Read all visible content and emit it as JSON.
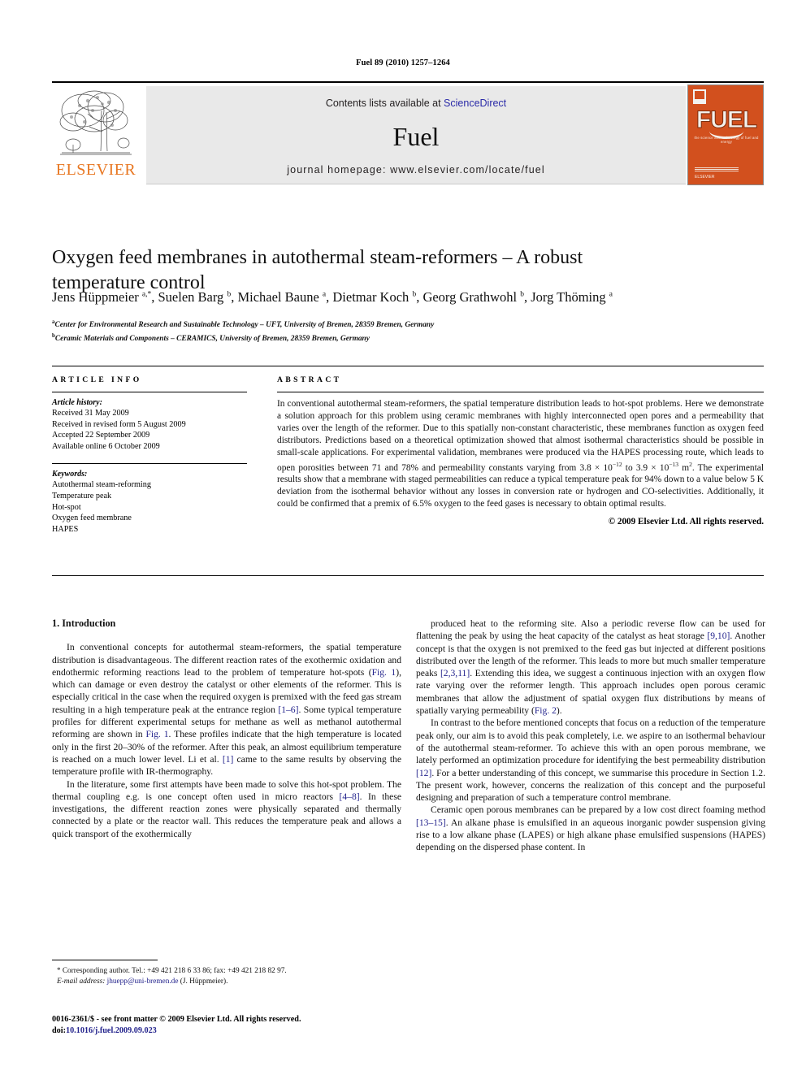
{
  "running_head": "Fuel 89 (2010) 1257–1264",
  "masthead": {
    "publisher_name": "ELSEVIER",
    "contents_prefix": "Contents lists available at ",
    "contents_link": "ScienceDirect",
    "journal_name": "Fuel",
    "homepage": "journal homepage: www.elsevier.com/locate/fuel",
    "cover_title": "FUEL",
    "cover_subtitle": "the science and technology of fuel and energy",
    "cover_brand": "ELSEVIER"
  },
  "article": {
    "title": "Oxygen feed membranes in autothermal steam-reformers – A robust temperature control",
    "authors_html": "Jens Hüppmeier <sup>a,*</sup>, Suelen Barg <sup>b</sup>, Michael Baune <sup>a</sup>, Dietmar Koch <sup>b</sup>, Georg Grathwohl <sup>b</sup>, Jorg Thöming <sup>a</sup>",
    "affiliation_a": "Center for Environmental Research and Sustainable Technology – UFT, University of Bremen, 28359 Bremen, Germany",
    "affiliation_b": "Ceramic Materials and Components – CERAMICS, University of Bremen, 28359 Bremen, Germany"
  },
  "article_info": {
    "heading": "ARTICLE INFO",
    "history_label": "Article history:",
    "history": [
      "Received 31 May 2009",
      "Received in revised form 5 August 2009",
      "Accepted 22 September 2009",
      "Available online 6 October 2009"
    ],
    "keywords_label": "Keywords:",
    "keywords": [
      "Autothermal steam-reforming",
      "Temperature peak",
      "Hot-spot",
      "Oxygen feed membrane",
      "HAPES"
    ]
  },
  "abstract": {
    "heading": "ABSTRACT",
    "body_html": "In conventional autothermal steam-reformers, the spatial temperature distribution leads to hot-spot problems. Here we demonstrate a solution approach for this problem using ceramic membranes with highly interconnected open pores and a permeability that varies over the length of the reformer. Due to this spatially non-constant characteristic, these membranes function as oxygen feed distributors. Predictions based on a theoretical optimization showed that almost isothermal characteristics should be possible in small-scale applications. For experimental validation, membranes were produced via the HAPES processing route, which leads to open porosities between 71 and 78% and permeability constants varying from 3.8 × 10<sup class=\"sm\">−12</sup> to 3.9 × 10<sup class=\"sm\">−13</sup> m<sup class=\"sm\">2</sup>. The experimental results show that a membrane with staged permeabilities can reduce a typical temperature peak for 94% down to a value below 5 K deviation from the isothermal behavior without any losses in conversion rate or hydrogen and CO-selectivities. Additionally, it could be confirmed that a premix of 6.5% oxygen to the feed gases is necessary to obtain optimal results.",
    "copyright": "© 2009 Elsevier Ltd. All rights reserved."
  },
  "body": {
    "section_heading": "1. Introduction",
    "left_p1_html": "In conventional concepts for autothermal steam-reformers, the spatial temperature distribution is disadvantageous. The different reaction rates of the exothermic oxidation and endothermic reforming reactions lead to the problem of temperature hot-spots (<span class=\"ref\">Fig. 1</span>), which can damage or even destroy the catalyst or other elements of the reformer. This is especially critical in the case when the required oxygen is premixed with the feed gas stream resulting in a high temperature peak at the entrance region <span class=\"ref\">[1–6]</span>. Some typical temperature profiles for different experimental setups for methane as well as methanol autothermal reforming are shown in <span class=\"ref\">Fig. 1</span>. These profiles indicate that the high temperature is located only in the first 20–30% of the reformer. After this peak, an almost equilibrium temperature is reached on a much lower level. Li et al. <span class=\"ref\">[1]</span> came to the same results by observing the temperature profile with IR-thermography.",
    "left_p2_html": "In the literature, some first attempts have been made to solve this hot-spot problem. The thermal coupling e.g. is one concept often used in micro reactors <span class=\"ref\">[4–8]</span>. In these investigations, the different reaction zones were physically separated and thermally connected by a plate or the reactor wall. This reduces the temperature peak and allows a quick transport of the exothermically",
    "right_p1_html": "produced heat to the reforming site. Also a periodic reverse flow can be used for flattening the peak by using the heat capacity of the catalyst as heat storage <span class=\"ref\">[9,10]</span>. Another concept is that the oxygen is not premixed to the feed gas but injected at different positions distributed over the length of the reformer. This leads to more but much smaller temperature peaks <span class=\"ref\">[2,3,11]</span>. Extending this idea, we suggest a continuous injection with an oxygen flow rate varying over the reformer length. This approach includes open porous ceramic membranes that allow the adjustment of spatial oxygen flux distributions by means of spatially varying permeability (<span class=\"ref\">Fig. 2</span>).",
    "right_p2_html": "In contrast to the before mentioned concepts that focus on a reduction of the temperature peak only, our aim is to avoid this peak completely, i.e. we aspire to an isothermal behaviour of the autothermal steam-reformer. To achieve this with an open porous membrane, we lately performed an optimization procedure for identifying the best permeability distribution <span class=\"ref\">[12]</span>. For a better understanding of this concept, we summarise this procedure in Section 1.2. The present work, however, concerns the realization of this concept and the purposeful designing and preparation of such a temperature control membrane.",
    "right_p3_html": "Ceramic open porous membranes can be prepared by a low cost direct foaming method <span class=\"ref\">[13–15]</span>. An alkane phase is emulsified in an aqueous inorganic powder suspension giving rise to a low alkane phase (LAPES) or high alkane phase emulsified suspensions (HAPES) depending on the dispersed phase content. In"
  },
  "footnote": {
    "corresponding_html": "<span class=\"fn-star\">*</span> Corresponding author. Tel.: +49 421 218 6 33 86; fax: +49 421 218 82 97.",
    "email_html": "<span class=\"fn-em\">E-mail address:</span> <span class=\"mail\">jhuepp@uni-bremen.de</span> (J. Hüppmeier)."
  },
  "colophon": {
    "issn_line": "0016-2361/$ - see front matter © 2009 Elsevier Ltd. All rights reserved.",
    "doi_label": "doi:",
    "doi_value": "10.1016/j.fuel.2009.09.023"
  },
  "colors": {
    "link": "#23238c",
    "elsevier_orange": "#E87722",
    "cover_orange": "#d2501e",
    "masthead_gray": "#e9e9e9"
  }
}
